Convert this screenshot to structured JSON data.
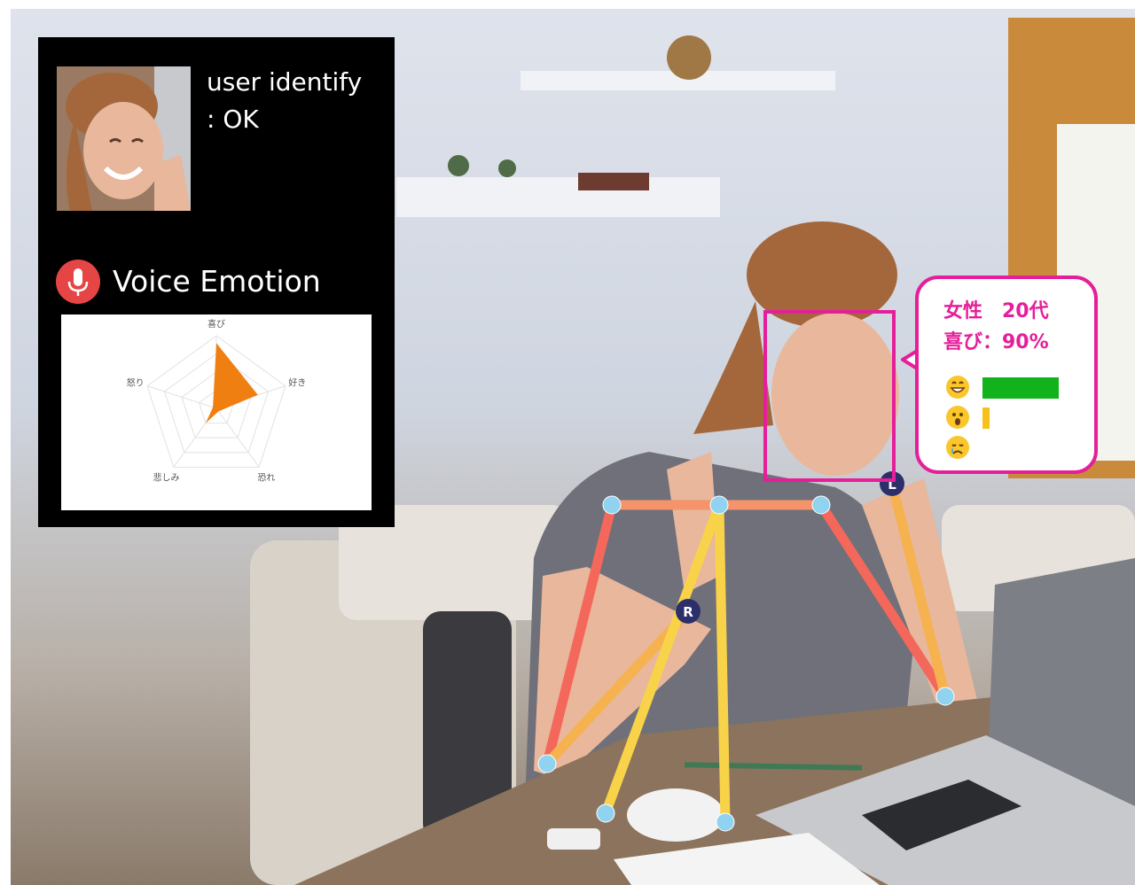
{
  "user_panel": {
    "status_line1": "user identify",
    "status_line2": ": OK"
  },
  "voice_emotion": {
    "title": "Voice Emotion",
    "radar": {
      "axes": [
        "喜び",
        "好き",
        "恐れ",
        "悲しみ",
        "怒り"
      ],
      "values": [
        0.9,
        0.6,
        0.05,
        0.25,
        0.05
      ],
      "fill_color": "#f07f12"
    }
  },
  "face_bubble": {
    "line1": "女性　20代",
    "line2": "喜び：90%",
    "emotions": [
      {
        "icon": "grinning-face-icon",
        "level": 0.9,
        "color": "#12b21c"
      },
      {
        "icon": "surprised-face-icon",
        "level": 0.08,
        "color": "#f7c11a"
      },
      {
        "icon": "sad-face-icon",
        "level": 0.0,
        "color": "#cccccc"
      }
    ],
    "accent_color": "#e51f9a"
  },
  "skeleton": {
    "right_badge": "R",
    "left_badge": "L"
  }
}
